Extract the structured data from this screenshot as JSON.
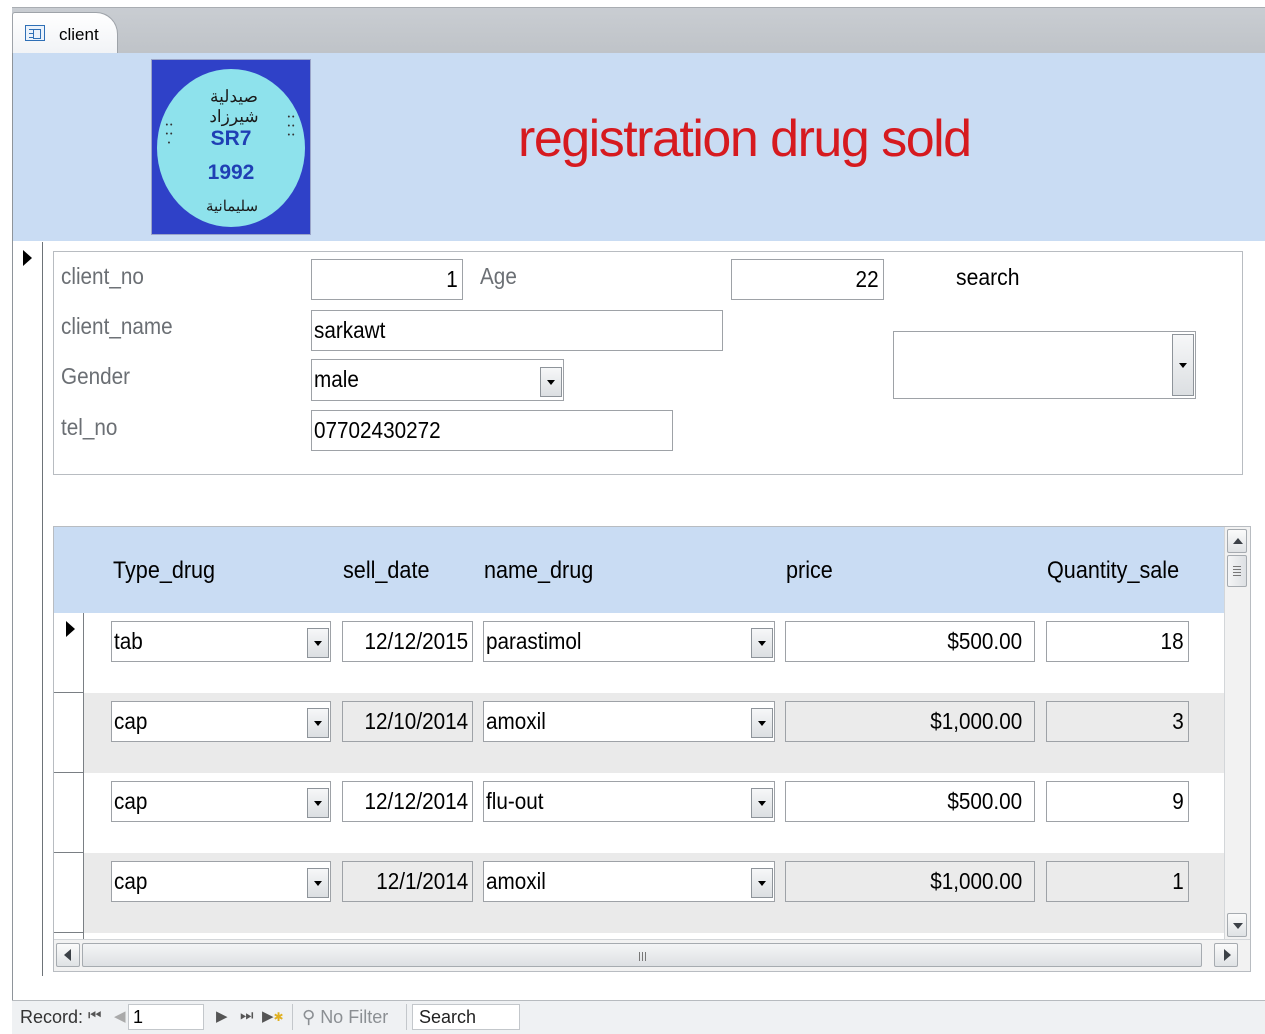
{
  "tab": {
    "label": "client",
    "icon": "form-icon"
  },
  "header": {
    "title": "registration drug sold",
    "logo": {
      "line1": "SR7",
      "line2": "1992",
      "arabic_top": "صيدلية شيرزاد",
      "arabic_bottom": "سليمانية"
    }
  },
  "client": {
    "labels": {
      "client_no": "client_no",
      "client_name": "client_name",
      "gender": "Gender",
      "tel_no": "tel_no",
      "age": "Age"
    },
    "values": {
      "client_no": "1",
      "client_name": "sarkawt",
      "gender": "male",
      "tel_no": "07702430272",
      "age": "22"
    }
  },
  "search": {
    "label": "search",
    "value": ""
  },
  "subform": {
    "columns": [
      "Type_drug",
      "sell_date",
      "name_drug",
      "price",
      "Quantity_sale"
    ],
    "rows": [
      {
        "type": "tab",
        "date": "12/12/2015",
        "name": "parastimol",
        "price": "$500.00",
        "qty": "18"
      },
      {
        "type": "cap",
        "date": "12/10/2014",
        "name": "amoxil",
        "price": "$1,000.00",
        "qty": "3"
      },
      {
        "type": "cap",
        "date": "12/12/2014",
        "name": "flu-out",
        "price": "$500.00",
        "qty": "9"
      },
      {
        "type": "cap",
        "date": "12/1/2014",
        "name": "amoxil",
        "price": "$1,000.00",
        "qty": "1"
      }
    ]
  },
  "navigation": {
    "record_label": "Record:",
    "record_value": "1",
    "first": "⏮",
    "prev": "◀",
    "next": "▶",
    "last": "⏭",
    "new": "▶",
    "filter_label": "No Filter",
    "search_label": "Search"
  }
}
